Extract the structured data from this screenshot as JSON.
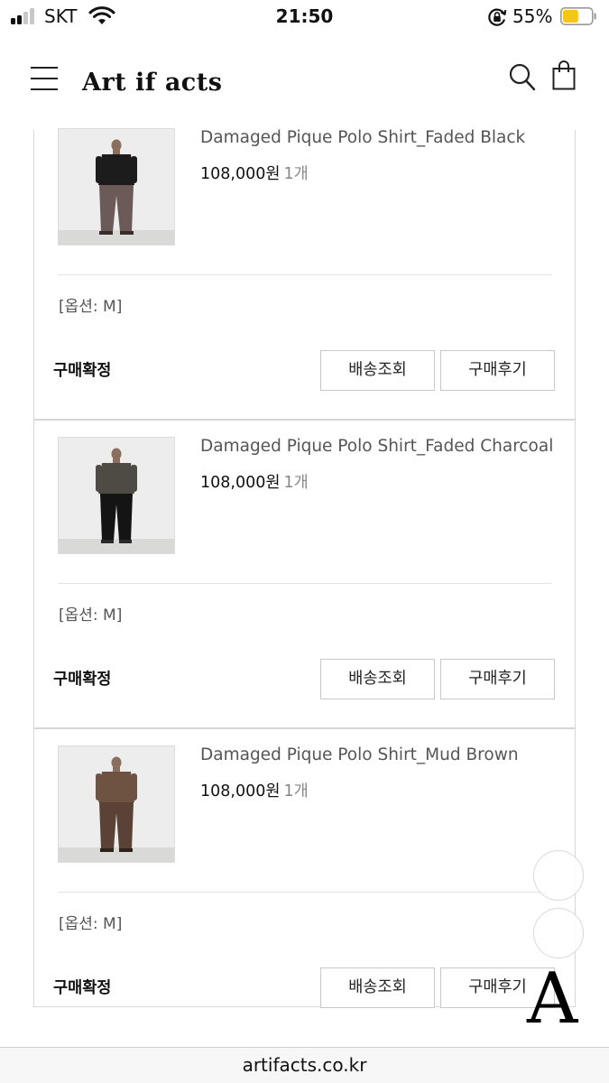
{
  "status_bar": {
    "carrier": "SKT",
    "time": "21:50",
    "battery_percent": "55%",
    "signal_bars": 4,
    "signal_bars_filled": 2,
    "battery_level": 0.55,
    "battery_color": "#f5c518"
  },
  "header": {
    "logo": "Art if acts",
    "menu_icon": "hamburger-menu-icon",
    "search_icon": "search-icon",
    "cart_icon": "shopping-bag-icon"
  },
  "orders": [
    {
      "product_name": "Damaged Pique Polo Shirt_Faded Black",
      "price": "108,000원",
      "quantity": "1개",
      "option": "[옵션: M]",
      "status": "구매확정",
      "delivery_button": "배송조회",
      "review_button": "구매후기",
      "top_color": "#1c1c1c",
      "pants_color": "#6b5a58"
    },
    {
      "product_name": "Damaged Pique Polo Shirt_Faded Charcoal",
      "price": "108,000원",
      "quantity": "1개",
      "option": "[옵션: M]",
      "status": "구매확정",
      "delivery_button": "배송조회",
      "review_button": "구매후기",
      "top_color": "#4e4a44",
      "pants_color": "#141414"
    },
    {
      "product_name": "Damaged Pique Polo Shirt_Mud Brown",
      "price": "108,000원",
      "quantity": "1개",
      "option": "[옵션: M]",
      "status": "구매확정",
      "delivery_button": "배송조회",
      "review_button": "구매후기",
      "top_color": "#6e5242",
      "pants_color": "#5a4236"
    }
  ],
  "watermark": "A",
  "url": "artifacts.co.kr"
}
